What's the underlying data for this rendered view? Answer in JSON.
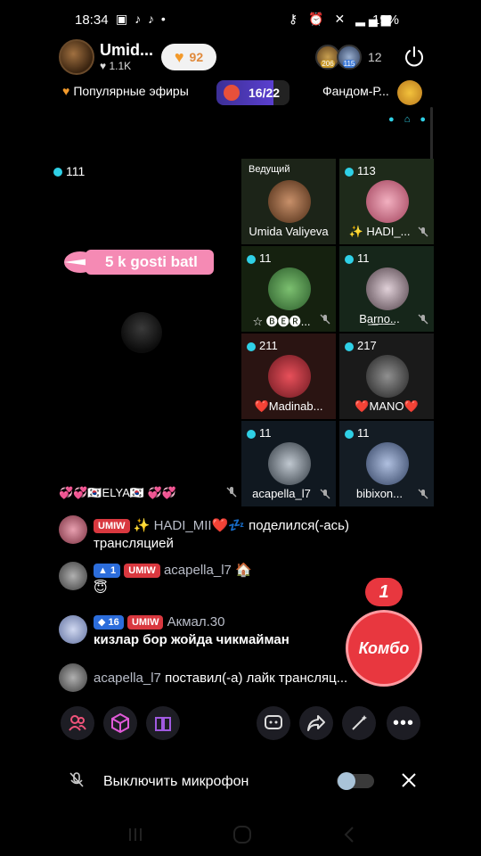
{
  "status_bar": {
    "time": "18:34",
    "battery": "19%"
  },
  "host": {
    "name": "Umid...",
    "likes": "1.1K",
    "hearts": "92"
  },
  "viewers": {
    "avatar_labels": [
      "206",
      "115"
    ],
    "count": "12"
  },
  "top_bar": {
    "popular_label": "Популярные эфиры",
    "progress": "16/22",
    "fandom_label": "Фандом-Р..."
  },
  "stage": {
    "main_count": "111",
    "banner": "5 k gosti batl",
    "left_name": "💞💞🇰🇷ELYA🇰🇷 💞💞"
  },
  "seats": [
    {
      "role": "Ведущий",
      "count": "",
      "name": "Umida Valiyeva",
      "muted": false
    },
    {
      "role": "",
      "count": "113",
      "name": "✨ HADI_...",
      "muted": true
    },
    {
      "role": "",
      "count": "11",
      "name": "☆ 🅑🅔🅡...",
      "muted": true
    },
    {
      "role": "",
      "count": "11",
      "name": "B͟a͟r͟n͟o͟...",
      "muted": true
    },
    {
      "role": "",
      "count": "211",
      "name": "❤️Madinab...",
      "muted": false
    },
    {
      "role": "",
      "count": "217",
      "name": "❤️MANO❤️",
      "muted": false
    },
    {
      "role": "",
      "count": "11",
      "name": "acapella_l7",
      "muted": true
    },
    {
      "role": "",
      "count": "11",
      "name": "bibixon...",
      "muted": true
    }
  ],
  "chat": [
    {
      "badges": [
        "UMIW"
      ],
      "user": "✨ HADI_MII❤️💤",
      "text": "поделился(-ась) трансляцией"
    },
    {
      "badges": [
        "1",
        "UMIW"
      ],
      "user": "acapella_l7 🏠",
      "text": "😇"
    },
    {
      "badges": [
        "16",
        "UMIW"
      ],
      "user": "Акмал.30",
      "text": "кизлар бор жойда чикмайман"
    },
    {
      "badges": [],
      "user": "acapella_l7",
      "text": "поставил(-а) лайк трансляц..."
    }
  ],
  "combo": {
    "count": "1",
    "label": "Комбо"
  },
  "mic_bar": {
    "label": "Выключить микрофон"
  },
  "colors": {
    "accent": "#2fd0e6",
    "combo": "#e8373f",
    "pink": "#f58ab4"
  }
}
